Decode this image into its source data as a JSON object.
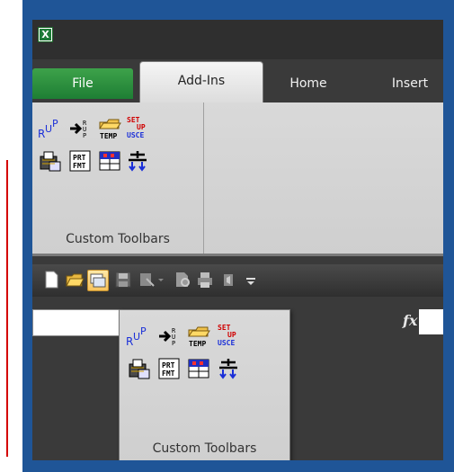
{
  "app": {
    "logo_letter": "X"
  },
  "tabs": [
    {
      "label": "File"
    },
    {
      "label": "Add-Ins"
    },
    {
      "label": "Home"
    },
    {
      "label": "Insert"
    }
  ],
  "ribbon": {
    "group_label": "Custom Toolbars",
    "icons": [
      {
        "name": "rup-icon",
        "text": "RUP"
      },
      {
        "name": "arrow-rup-icon",
        "text": "R U P"
      },
      {
        "name": "temp-folder-icon",
        "text": "TEMP"
      },
      {
        "name": "setup-usce-icon",
        "text": "SET UP USCE"
      },
      {
        "name": "basket-note-icon",
        "text": ""
      },
      {
        "name": "prt-fmt-icon",
        "text": "PRT FMT"
      },
      {
        "name": "grid-table-icon",
        "text": ""
      },
      {
        "name": "split-arrows-icon",
        "text": ""
      }
    ]
  },
  "qat": {
    "icons": [
      "new-document-icon",
      "open-folder-icon",
      "custom-toolbars-button-icon",
      "save-icon",
      "undo-icon",
      "print-preview-icon",
      "print-icon",
      "speaker-icon",
      "customize-dropdown-icon"
    ]
  },
  "formula": {
    "fx_label": "fx"
  },
  "dropdown": {
    "group_label": "Custom Toolbars"
  },
  "colors": {
    "file_tab": "#2f8f3e",
    "frame": "#1f5597",
    "highlight": "#f6c35d"
  }
}
